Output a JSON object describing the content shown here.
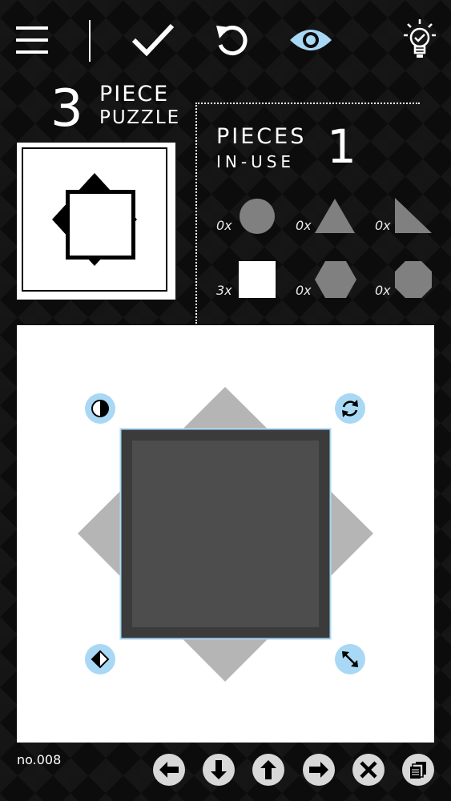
{
  "toolbar": {
    "icons": [
      "menu-icon",
      "check-icon",
      "undo-icon",
      "eye-icon",
      "lightbulb-icon"
    ]
  },
  "title": {
    "number": "3",
    "line1": "PIECE",
    "line2": "PUZZLE"
  },
  "pieces_in_use": {
    "line1": "PIECES",
    "line2": "IN-USE",
    "count": "1"
  },
  "inventory": [
    {
      "count": "0x",
      "shape": "circle"
    },
    {
      "count": "0x",
      "shape": "triangle"
    },
    {
      "count": "0x",
      "shape": "right-triangle"
    },
    {
      "count": "3x",
      "shape": "square"
    },
    {
      "count": "0x",
      "shape": "hexagon"
    },
    {
      "count": "0x",
      "shape": "octagon"
    }
  ],
  "board": {
    "handles": [
      "half-circle-icon",
      "rotate-icon",
      "flip-icon",
      "resize-icon"
    ],
    "accent_color": "#a9d8f5",
    "piece_color": "#3b3b3b",
    "ghost_color": "#b5b5b5"
  },
  "footer": {
    "level": "no.008",
    "buttons": [
      "arrow-left-icon",
      "arrow-down-icon",
      "arrow-up-icon",
      "arrow-right-icon",
      "close-icon",
      "stack-icon"
    ]
  }
}
